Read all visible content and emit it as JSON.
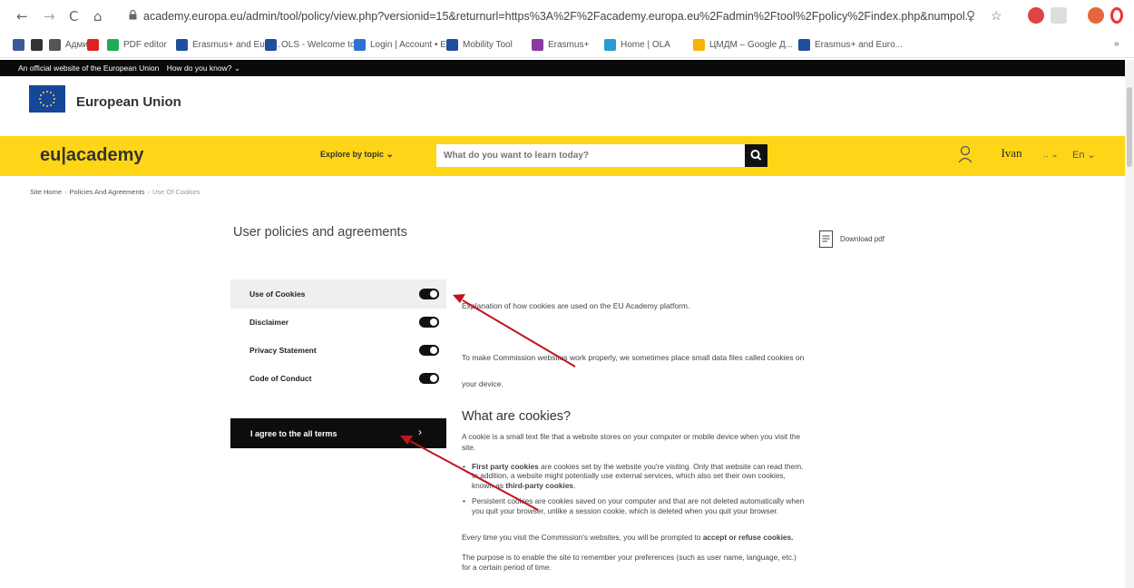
{
  "browser": {
    "url": "academy.europa.eu/admin/tool/policy/view.php?versionid=15&returnurl=https%3A%2F%2Facademy.europa.eu%2Fadmin%2Ftool%2Fpolicy%2Findex.php&numpol...",
    "bookmarks": [
      {
        "label": "",
        "color": "#3b5998"
      },
      {
        "label": "",
        "color": "#333333"
      },
      {
        "label": "Админ",
        "color": "#555555"
      },
      {
        "label": "",
        "color": "#e02020"
      },
      {
        "label": "PDF editor",
        "color": "#22aa55"
      },
      {
        "label": "Erasmus+ and Euro...",
        "color": "#1f4e9e"
      },
      {
        "label": "OLS - Welcome to...",
        "color": "#1f4e9e"
      },
      {
        "label": "Login | Account • Er...",
        "color": "#3070d0"
      },
      {
        "label": "Mobility Tool",
        "color": "#1f4e9e"
      },
      {
        "label": "Erasmus+",
        "color": "#8a3aa0"
      },
      {
        "label": "Home | OLA",
        "color": "#2a9bd4"
      },
      {
        "label": "ЦМДМ – Google Д...",
        "color": "#f4b400"
      },
      {
        "label": "Erasmus+ and Euro...",
        "color": "#1f4e9e"
      }
    ],
    "more_label": "»"
  },
  "eu_banner": {
    "text": "An official website of the European Union",
    "link": "How do you know?"
  },
  "eu_header": {
    "name": "European Union"
  },
  "header": {
    "logo": "eu|academy",
    "explore": "Explore by topic",
    "search_placeholder": "What do you want to learn today?",
    "user_name": "Ivan",
    "language": "En"
  },
  "breadcrumb": [
    "Site Home",
    "Policies And Agreements",
    "Use Of Cookies"
  ],
  "page": {
    "title": "User policies and agreements",
    "download": "Download pdf"
  },
  "policies": [
    {
      "label": "Use of Cookies",
      "active": true
    },
    {
      "label": "Disclaimer",
      "active": false
    },
    {
      "label": "Privacy Statement",
      "active": false
    },
    {
      "label": "Code of Conduct",
      "active": false
    }
  ],
  "agree_button": "I agree to the all terms",
  "content": {
    "intro": "Explanation of how cookies are used on the EU Academy platform.",
    "p1_a": "To make Commission websites work properly, we sometimes place small data files called cookies on",
    "p1_b": "your device.",
    "heading": "What are cookies?",
    "p2_a": "A cookie is a small text file that a website stores on your computer or mobile device when you visit the",
    "p2_b": "site.",
    "b1_bold": "First party cookies",
    "b1_a": " are cookies set by the website you're visiting. Only that website can read them.",
    "b1_b": "In addition, a website might potentially use external services, which also set their own cookies,",
    "b1_c_pre": "known as ",
    "b1_c_bold": "third-party cookies",
    "b1_c_post": ".",
    "b2_a": "Persistent cookies are cookies saved on your computer and that are not deleted automatically when",
    "b2_b": "you quit your browser, unlike a session cookie, which is deleted when you quit your browser.",
    "p3_pre": "Every time you visit the Commission's websites, you will be prompted to ",
    "p3_bold": "accept or refuse cookies.",
    "p4_a": "The purpose is to enable the site to remember your preferences (such as user name, language, etc.)",
    "p4_b": "for a certain period of time."
  },
  "colors": {
    "brand_yellow": "#ffd617",
    "annotation_red": "#c0141e",
    "eu_blue": "#154699"
  }
}
